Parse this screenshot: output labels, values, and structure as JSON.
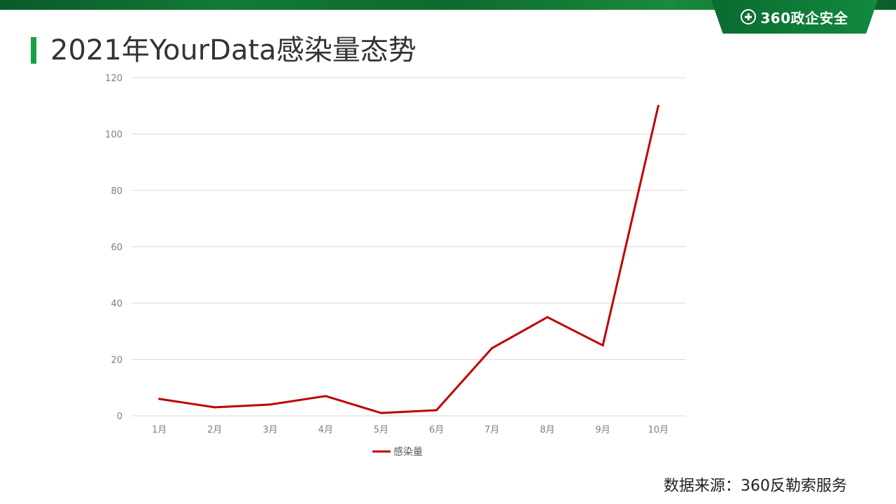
{
  "header": {
    "title": "2021年YourData感染量态势",
    "logo_text": "360政企安全"
  },
  "footer": {
    "source": "数据来源：360反勒索服务"
  },
  "colors": {
    "brand_green": "#118a3e",
    "accent_green": "#1aa04a",
    "series_red": "#c00000",
    "gridline": "#d9d9d9"
  },
  "chart_data": {
    "type": "line",
    "categories": [
      "1月",
      "2月",
      "3月",
      "4月",
      "5月",
      "6月",
      "7月",
      "8月",
      "9月",
      "10月"
    ],
    "series": [
      {
        "name": "感染量",
        "values": [
          6,
          3,
          4,
          7,
          1,
          2,
          24,
          35,
          25,
          110
        ],
        "color": "#c00000"
      }
    ],
    "ylim": [
      0,
      120
    ],
    "yticks": [
      0,
      20,
      40,
      60,
      80,
      100,
      120
    ],
    "grid": true,
    "legend": "bottom"
  }
}
